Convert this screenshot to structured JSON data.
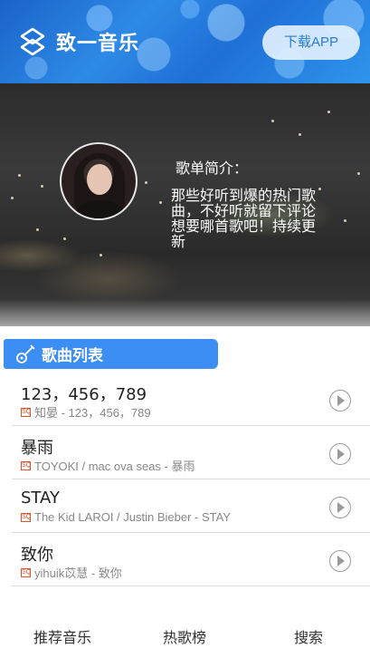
{
  "header": {
    "logo_text": "致一音乐",
    "download_label": "下载APP"
  },
  "intro": {
    "title": "歌单简介：",
    "description": "那些好听到爆的热门歌曲，不好听就留下评论想要哪首歌吧！持续更新"
  },
  "section": {
    "title": "歌曲列表"
  },
  "badge_text": "SQ",
  "songs": [
    {
      "name": "123，456，789",
      "artist": "知晏 - 123，456，789"
    },
    {
      "name": "暴雨",
      "artist": "TOYOKI / mac ova seas - 暴雨"
    },
    {
      "name": "STAY",
      "artist": "The Kid LAROI / Justin Bieber - STAY"
    },
    {
      "name": "致你",
      "artist": "yihuik苡慧 - 致你"
    }
  ],
  "nav": {
    "items": [
      "推荐音乐",
      "热歌榜",
      "搜索"
    ]
  },
  "colors": {
    "accent": "#3d8ef2",
    "header_start": "#1a63c9",
    "header_end": "#2f95ec",
    "badge": "#e0532a"
  }
}
